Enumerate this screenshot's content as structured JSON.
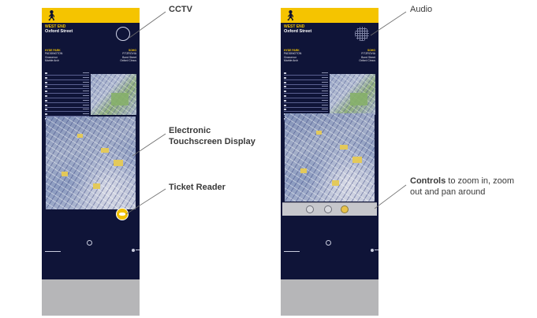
{
  "left_totem": {
    "area": "WEST END",
    "street": "Oxford Street",
    "dir_left": [
      "HYDE PARK",
      "PADDINGTON",
      "Grosvenor",
      "Marble Arch"
    ],
    "dir_right": [
      "SOHO",
      "FITZROVIA",
      "Bond Street",
      "Oxford Circus"
    ]
  },
  "right_totem": {
    "area": "WEST END",
    "street": "Oxford Street",
    "dir_left": [
      "HYDE PARK",
      "PADDINGTON",
      "Grosvenor",
      "Marble Arch"
    ],
    "dir_right": [
      "SOHO",
      "FITZROVIA",
      "Bond Street",
      "Oxford Circus"
    ]
  },
  "callouts": {
    "cctv": "CCTV",
    "display_line1": "Electronic",
    "display_line2": "Touchscreen Display",
    "ticket_reader": "Ticket Reader",
    "audio": "Audio",
    "controls_bold": "Controls",
    "controls_rest": "to zoom in, zoom",
    "controls_line2": "out and pan around"
  },
  "icons": {
    "pedestrian": "walking-person-icon",
    "cctv": "camera-dome-icon",
    "audio": "speaker-grille-icon",
    "ticket": "card-reader-icon"
  },
  "colors": {
    "navy": "#0f1438",
    "yellow": "#f5c400",
    "grey": "#b6b6b8"
  }
}
